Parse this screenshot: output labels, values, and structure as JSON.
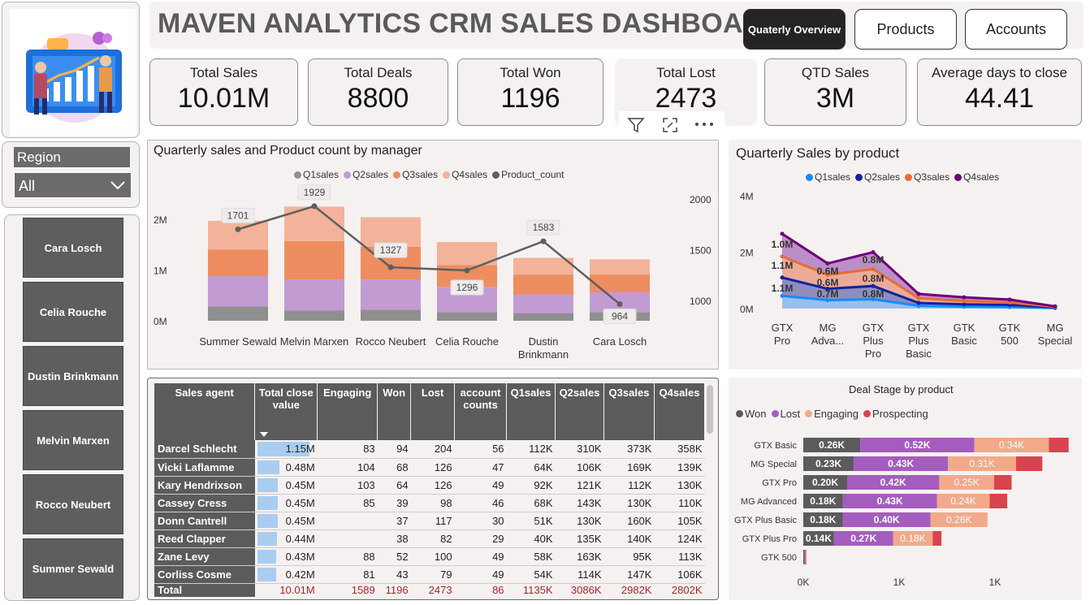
{
  "header": {
    "title": "MAVEN ANALYTICS CRM SALES DASHBOARD",
    "nav": [
      {
        "label": "Quaterly Overview",
        "active": true
      },
      {
        "label": "Products",
        "active": false
      },
      {
        "label": "Accounts",
        "active": false
      }
    ]
  },
  "kpis": [
    {
      "label": "Total Sales",
      "value": "10.01M"
    },
    {
      "label": "Total Deals",
      "value": "8800"
    },
    {
      "label": "Total Won",
      "value": "1196"
    },
    {
      "label": "Total Lost",
      "value": "2473"
    },
    {
      "label": "QTD Sales",
      "value": "3M"
    },
    {
      "label": "Average days to close",
      "value": "44.41"
    }
  ],
  "region_filter": {
    "label": "Region",
    "selected": "All"
  },
  "managers": [
    "Cara Losch",
    "Celia Rouche",
    "Dustin Brinkmann",
    "Melvin Marxen",
    "Rocco Neubert",
    "Summer Sewald"
  ],
  "colors": {
    "q1_grey": "#8f8f8f",
    "q2_purple": "#c39bd3",
    "q3_orange": "#ee9a6b",
    "q4_peach": "#f2b39a",
    "line": "#5f5f5f",
    "p_q1": "#118dff",
    "p_q2": "#12239e",
    "p_q3": "#e66c37",
    "p_q4": "#6b007b",
    "won": "#5b5b5b",
    "lost": "#a45dbf",
    "engaging": "#f2a98a",
    "prospecting": "#d9434e"
  },
  "chart_data": [
    {
      "type": "bar",
      "title": "Quarterly sales and Product count by manager",
      "legend": [
        "Q1sales",
        "Q2sales",
        "Q3sales",
        "Q4sales",
        "Product_count"
      ],
      "categories": [
        "Summer Sewald",
        "Melvin Marxen",
        "Rocco Neubert",
        "Celia Rouche",
        "Dustin Brinkmann",
        "Cara Losch"
      ],
      "series": [
        {
          "name": "Q1sales",
          "values": [
            0.28,
            0.2,
            0.22,
            0.17,
            0.15,
            0.17
          ]
        },
        {
          "name": "Q2sales",
          "values": [
            0.6,
            0.61,
            0.59,
            0.5,
            0.37,
            0.39
          ]
        },
        {
          "name": "Q3sales",
          "values": [
            0.52,
            0.76,
            0.65,
            0.43,
            0.39,
            0.35
          ]
        },
        {
          "name": "Q4sales",
          "values": [
            0.57,
            0.68,
            0.58,
            0.45,
            0.33,
            0.3
          ]
        }
      ],
      "line": {
        "name": "Product_count",
        "values": [
          1701,
          1929,
          1327,
          1296,
          1583,
          964
        ]
      },
      "y_ticks": [
        "0M",
        "1M",
        "2M"
      ],
      "y2_ticks": [
        "1000",
        "1500",
        "2000"
      ],
      "ylim": [
        0,
        2.4
      ],
      "y2lim": [
        800,
        2000
      ]
    },
    {
      "type": "area",
      "title": "Quarterly Sales by product",
      "legend": [
        "Q1sales",
        "Q2sales",
        "Q3sales",
        "Q4sales"
      ],
      "categories": [
        "GTX Pro",
        "MG Adva...",
        "GTX Plus Pro",
        "GTX Plus Basic",
        "GTK Basic",
        "GTK 500",
        "MG Special"
      ],
      "series": [
        {
          "name": "Q1sales",
          "values": [
            0.45,
            0.3,
            0.33,
            0.1,
            0.07,
            0.05,
            0.02
          ]
        },
        {
          "name": "Q2sales",
          "values": [
            1.1,
            0.7,
            0.8,
            0.2,
            0.15,
            0.13,
            0.04
          ]
        },
        {
          "name": "Q3sales",
          "values": [
            1.85,
            1.2,
            1.4,
            0.37,
            0.27,
            0.22,
            0.06
          ]
        },
        {
          "name": "Q4sales",
          "values": [
            2.65,
            1.6,
            2.0,
            0.52,
            0.4,
            0.32,
            0.08
          ]
        }
      ],
      "labels": [
        {
          "cat": 0,
          "text": "1.0M",
          "y": 2.3
        },
        {
          "cat": 0,
          "text": "1.1M",
          "y": 1.55
        },
        {
          "cat": 0,
          "text": "1.1M",
          "y": 0.75
        },
        {
          "cat": 1,
          "text": "0.6M",
          "y": 1.35
        },
        {
          "cat": 1,
          "text": "0.6M",
          "y": 0.95
        },
        {
          "cat": 1,
          "text": "0.7M",
          "y": 0.55
        },
        {
          "cat": 2,
          "text": "0.8M",
          "y": 1.75
        },
        {
          "cat": 2,
          "text": "0.8M",
          "y": 1.1
        },
        {
          "cat": 2,
          "text": "0.8M",
          "y": 0.55
        }
      ],
      "y_ticks": [
        "0M",
        "2M",
        "4M"
      ],
      "ylim": [
        0,
        4
      ]
    },
    {
      "type": "bar",
      "orientation": "horizontal",
      "title": "Deal Stage by product",
      "legend": [
        "Won",
        "Lost",
        "Engaging",
        "Prospecting"
      ],
      "categories": [
        "GTX Basic",
        "MG Special",
        "GTX Pro",
        "MG Advanced",
        "GTX Plus Basic",
        "GTX Plus Pro",
        "GTK 500"
      ],
      "series": [
        {
          "name": "Won",
          "values": [
            0.26,
            0.23,
            0.2,
            0.18,
            0.18,
            0.14,
            0.005
          ],
          "labels": [
            "0.26K",
            "0.23K",
            "0.20K",
            "0.18K",
            "0.18K",
            "0.14K",
            ""
          ]
        },
        {
          "name": "Lost",
          "values": [
            0.52,
            0.43,
            0.42,
            0.43,
            0.4,
            0.27,
            0.006
          ],
          "labels": [
            "0.52K",
            "0.43K",
            "0.42K",
            "0.43K",
            "0.40K",
            "0.27K",
            ""
          ]
        },
        {
          "name": "Engaging",
          "values": [
            0.34,
            0.31,
            0.25,
            0.24,
            0.26,
            0.18,
            0.003
          ],
          "labels": [
            "0.34K",
            "0.31K",
            "0.25K",
            "0.24K",
            "0.26K",
            "0.18K",
            ""
          ]
        },
        {
          "name": "Prospecting",
          "values": [
            0.09,
            0.12,
            0.08,
            0.08,
            0.0,
            0.04,
            0.001
          ],
          "labels": [
            "",
            "",
            "",
            "",
            "",
            "",
            ""
          ]
        }
      ],
      "x_ticks": [
        "0K",
        "1K",
        "1K"
      ]
    }
  ],
  "table": {
    "headers": [
      "Sales agent",
      "Total close value",
      "Engaging",
      "Won",
      "Lost",
      "account counts",
      "Q1sales",
      "Q2sales",
      "Q3sales",
      "Q4sales"
    ],
    "rows": [
      {
        "agent": "Darcel Schlecht",
        "total": "1.15M",
        "bar": 1.0,
        "engaging": "83",
        "won": "94",
        "lost": "204",
        "accounts": "56",
        "q1": "112K",
        "q2": "310K",
        "q3": "373K",
        "q4": "358K"
      },
      {
        "agent": "Vicki Laflamme",
        "total": "0.48M",
        "bar": 0.42,
        "engaging": "104",
        "won": "68",
        "lost": "126",
        "accounts": "47",
        "q1": "64K",
        "q2": "106K",
        "q3": "169K",
        "q4": "139K"
      },
      {
        "agent": "Kary Hendrixson",
        "total": "0.45M",
        "bar": 0.39,
        "engaging": "103",
        "won": "64",
        "lost": "126",
        "accounts": "49",
        "q1": "92K",
        "q2": "121K",
        "q3": "112K",
        "q4": "130K"
      },
      {
        "agent": "Cassey Cress",
        "total": "0.45M",
        "bar": 0.39,
        "engaging": "85",
        "won": "39",
        "lost": "98",
        "accounts": "46",
        "q1": "68K",
        "q2": "143K",
        "q3": "130K",
        "q4": "110K"
      },
      {
        "agent": "Donn Cantrell",
        "total": "0.45M",
        "bar": 0.39,
        "engaging": "",
        "won": "37",
        "lost": "117",
        "accounts": "30",
        "q1": "51K",
        "q2": "130K",
        "q3": "160K",
        "q4": "105K"
      },
      {
        "agent": "Reed Clapper",
        "total": "0.44M",
        "bar": 0.38,
        "engaging": "",
        "won": "38",
        "lost": "82",
        "accounts": "29",
        "q1": "40K",
        "q2": "135K",
        "q3": "140K",
        "q4": "124K"
      },
      {
        "agent": "Zane Levy",
        "total": "0.43M",
        "bar": 0.37,
        "engaging": "88",
        "won": "52",
        "lost": "100",
        "accounts": "49",
        "q1": "58K",
        "q2": "163K",
        "q3": "95K",
        "q4": "113K"
      },
      {
        "agent": "Corliss Cosme",
        "total": "0.42M",
        "bar": 0.36,
        "engaging": "81",
        "won": "43",
        "lost": "79",
        "accounts": "49",
        "q1": "54K",
        "q2": "114K",
        "q3": "147K",
        "q4": "106K"
      }
    ],
    "total": {
      "agent": "Total",
      "total": "10.01M",
      "engaging": "1589",
      "won": "1196",
      "lost": "2473",
      "accounts": "86",
      "q1": "1135K",
      "q2": "3086K",
      "q3": "2982K",
      "q4": "2802K"
    }
  },
  "icons": [
    "filter-icon",
    "focus-mode-icon",
    "more-options-icon",
    "chevron-down-icon",
    "sort-arrow-icon"
  ]
}
